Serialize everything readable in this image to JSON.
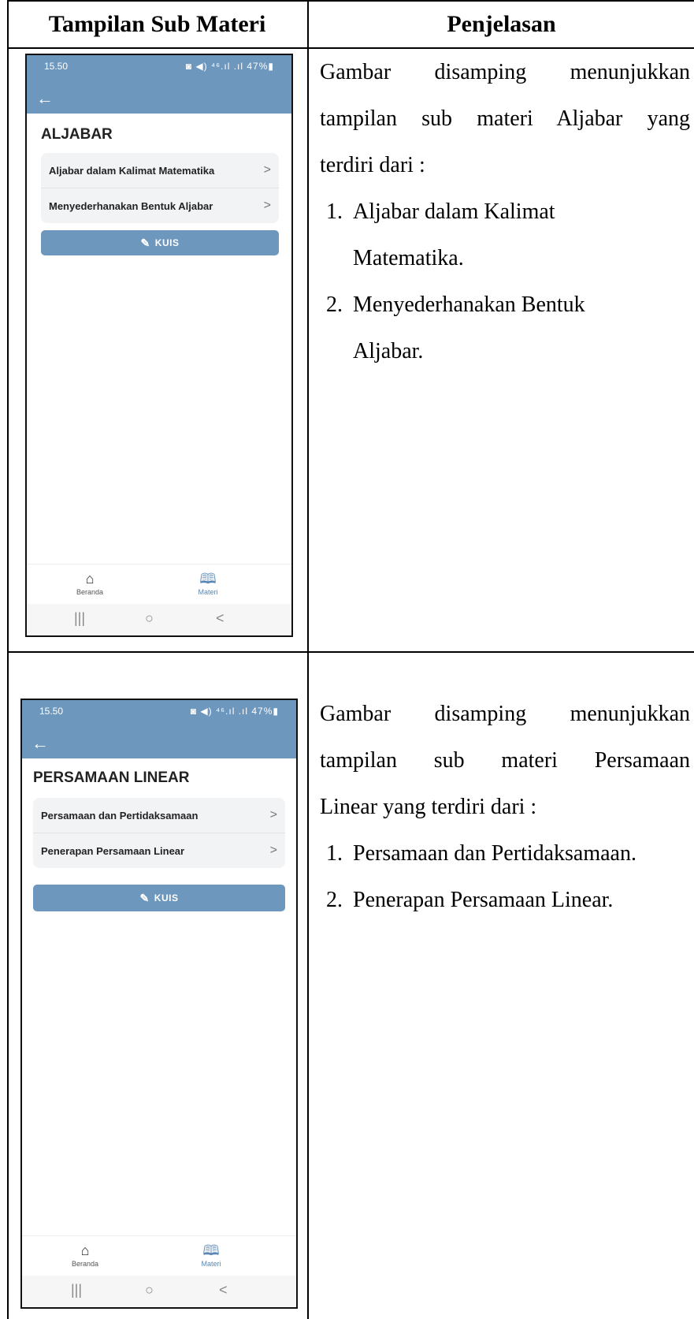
{
  "table": {
    "headers": [
      "Tampilan Sub Materi",
      "Penjelasan"
    ]
  },
  "rows": [
    {
      "phone": {
        "time": "15.50",
        "status_icons": "◙ ◀) ⁴⁶.ıl .ıl 47%▮",
        "back_icon": "arrow-left-icon",
        "title": "ALJABAR",
        "items": [
          {
            "label": "Aljabar dalam Kalimat Matematika",
            "chevron": ">"
          },
          {
            "label": "Menyederhanakan Bentuk Aljabar",
            "chevron": ">"
          }
        ],
        "quiz_button": "KUIS",
        "nav": [
          {
            "label": "Beranda",
            "icon": "home-icon"
          },
          {
            "label": "Materi",
            "icon": "book-icon"
          }
        ],
        "system_nav": [
          "|||",
          "○",
          "<"
        ]
      },
      "explanation": {
        "line1": "Gambar disamping menunjukkan",
        "line2": "tampilan sub materi Aljabar  yang",
        "line3": "terdiri dari :",
        "items": [
          {
            "num": "1.",
            "line_a": "Aljabar dalam Kalimat",
            "line_b": "Matematika."
          },
          {
            "num": "2.",
            "line_a": "Menyederhanakan Bentuk",
            "line_b": "Aljabar."
          }
        ]
      }
    },
    {
      "phone": {
        "time": "15.50",
        "status_icons": "◙ ◀) ⁴⁶.ıl .ıl 47%▮",
        "back_icon": "arrow-left-icon",
        "title": "PERSAMAAN LINEAR",
        "items": [
          {
            "label": "Persamaan dan Pertidaksamaan",
            "chevron": ">"
          },
          {
            "label": "Penerapan Persamaan Linear",
            "chevron": ">"
          }
        ],
        "quiz_button": "KUIS",
        "nav": [
          {
            "label": "Beranda",
            "icon": "home-icon"
          },
          {
            "label": "Materi",
            "icon": "book-icon"
          }
        ],
        "system_nav": [
          "|||",
          "○",
          "<"
        ]
      },
      "explanation": {
        "line1": "Gambar disamping menunjukkan",
        "line2": "tampilan sub materi Persamaan",
        "line3": "Linear  yang terdiri dari :",
        "items": [
          {
            "num": "1.",
            "line_a": "Persamaan dan Pertidaksamaan."
          },
          {
            "num": "2.",
            "line_a": "Penerapan Persamaan Linear."
          }
        ]
      }
    }
  ]
}
